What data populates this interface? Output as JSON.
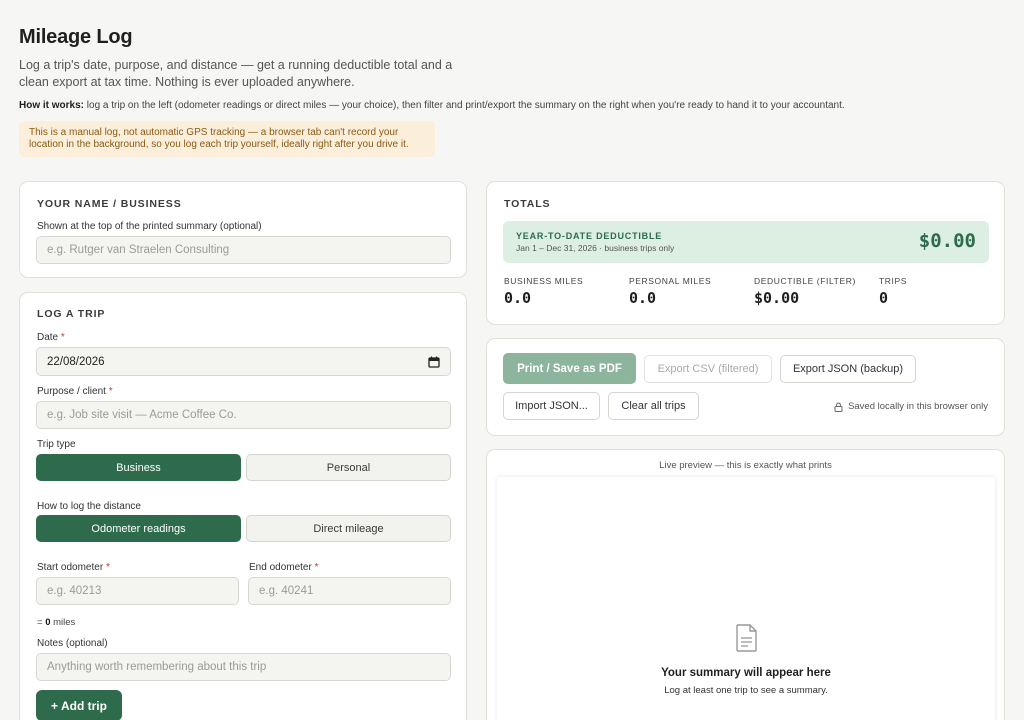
{
  "header": {
    "title": "Mileage Log",
    "subtitle": "Log a trip's date, purpose, and distance — get a running deductible total and a clean export at tax time. Nothing is ever uploaded anywhere.",
    "how_label": "How it works:",
    "how_text": "log a trip on the left (odometer readings or direct miles — your choice), then filter and print/export the summary on the right when you're ready to hand it to your accountant.",
    "notice": "This is a manual log, not automatic GPS tracking — a browser tab can't record your location in the background, so you log each trip yourself, ideally right after you drive it."
  },
  "name_card": {
    "title": "Your name / business",
    "label": "Shown at the top of the printed summary (optional)",
    "placeholder": "e.g. Rutger van Straelen Consulting"
  },
  "trip_card": {
    "title": "Log a trip",
    "date_label": "Date",
    "date_value": "22/08/2026",
    "purpose_label": "Purpose / client",
    "purpose_placeholder": "e.g. Job site visit — Acme Coffee Co.",
    "trip_type_label": "Trip type",
    "trip_type_options": [
      "Business",
      "Personal"
    ],
    "trip_type_selected": "Business",
    "distance_label": "How to log the distance",
    "distance_options": [
      "Odometer readings",
      "Direct mileage"
    ],
    "distance_selected": "Odometer readings",
    "start_label": "Start odometer",
    "start_placeholder": "e.g. 40213",
    "end_label": "End odometer",
    "end_placeholder": "e.g. 40241",
    "computed_prefix": "=",
    "computed_value": "0",
    "computed_unit": "miles",
    "notes_label": "Notes (optional)",
    "notes_placeholder": "Anything worth remembering about this trip",
    "add_button": "+ Add trip",
    "required_mark": "*"
  },
  "totals": {
    "title": "Totals",
    "ytd_label": "Year-to-date deductible",
    "ytd_sub": "Jan 1 – Dec 31, 2026 · business trips only",
    "ytd_value": "$0.00",
    "stats": [
      {
        "label": "Business miles",
        "value": "0.0"
      },
      {
        "label": "Personal miles",
        "value": "0.0"
      },
      {
        "label": "Deductible (filter)",
        "value": "$0.00"
      },
      {
        "label": "Trips",
        "value": "0"
      }
    ]
  },
  "actions": {
    "print": "Print / Save as PDF",
    "export_csv": "Export CSV (filtered)",
    "export_json": "Export JSON (backup)",
    "import_json": "Import JSON...",
    "clear": "Clear all trips",
    "saved_note": "Saved locally in this browser only"
  },
  "preview": {
    "caption": "Live preview — this is exactly what prints",
    "empty_title": "Your summary will appear here",
    "empty_sub": "Log at least one trip to see a summary."
  },
  "colors": {
    "accent": "#2e6b4c",
    "accent_soft": "#dcefe2",
    "notice_bg": "#fbeedb",
    "notice_text": "#8a5a12"
  }
}
